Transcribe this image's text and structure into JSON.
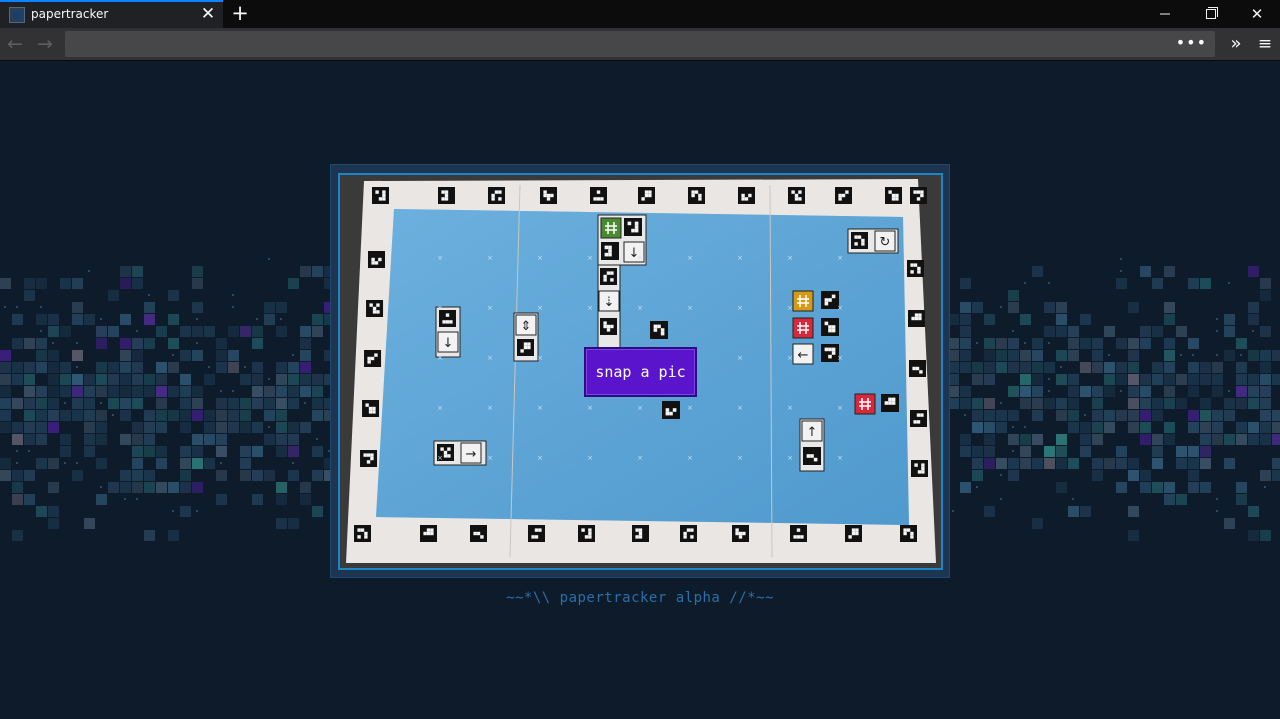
{
  "browser": {
    "tab_title": "papertracker",
    "tab_close": "✕",
    "new_tab": "+",
    "window_controls": {
      "minimize": "—",
      "close": "✕"
    },
    "nav": {
      "back": "←",
      "forward": "→",
      "url_more": "•••",
      "overflow": "»",
      "menu": "≡"
    },
    "url": ""
  },
  "page": {
    "snap_button_label": "snap a pic",
    "footer_text": "~~*\\\\ papertracker alpha //*~~"
  },
  "colors": {
    "page_bg": "#0e1b2b",
    "frame_border": "#1c86c8",
    "snap_button": "#5a14cc",
    "footer_text": "#2b6fa8",
    "tile_green": "#4a8a30",
    "tile_orange": "#d49a18",
    "tile_red": "#d8283c",
    "board_blue": "#5aa4d6"
  },
  "icons": [
    "favicon-icon",
    "close-icon",
    "plus-icon",
    "minimize-icon",
    "maximize-icon",
    "back-arrow-icon",
    "forward-arrow-icon",
    "page-actions-icon",
    "overflow-icon",
    "hamburger-menu-icon"
  ]
}
